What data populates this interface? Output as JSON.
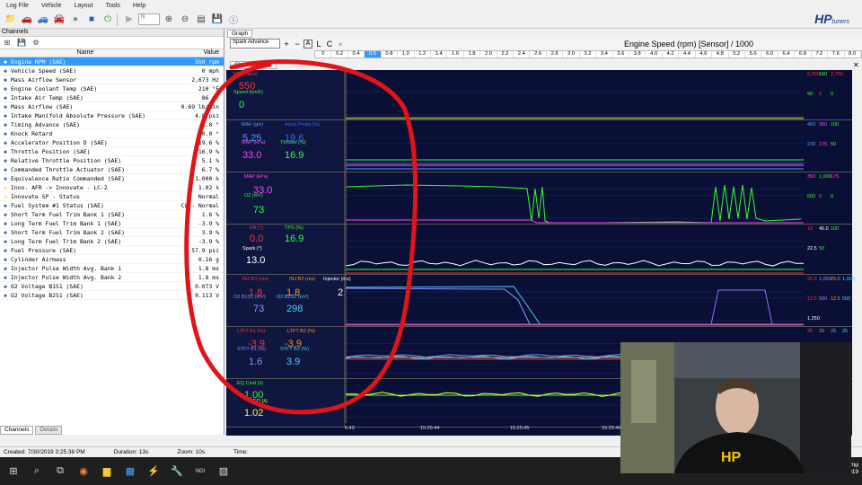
{
  "menu": [
    "Log File",
    "Vehicle",
    "Layout",
    "Tools",
    "Help"
  ],
  "toolbar": {
    "combo_value": "N"
  },
  "logo": {
    "text": "HP",
    "sub": "tuners"
  },
  "channels": {
    "header": "Channels",
    "col_name": "Name",
    "col_value": "Value",
    "rows": [
      {
        "name": "Engine RPM (SAE)",
        "value": "550 rpm",
        "selected": true
      },
      {
        "name": "Vehicle Speed (SAE)",
        "value": "0 mph"
      },
      {
        "name": "Mass Airflow Sensor",
        "value": "2,673 Hz"
      },
      {
        "name": "Engine Coolant Temp (SAE)",
        "value": "210 °F"
      },
      {
        "name": "Intake Air Temp (SAE)",
        "value": "86 °F"
      },
      {
        "name": "Mass Airflow (SAE)",
        "value": "0.69 lb/min"
      },
      {
        "name": "Intake Manifold Absolute Pressure (SAE)",
        "value": "4.8 psi"
      },
      {
        "name": "Timing Advance (SAE)",
        "value": "3.0 °"
      },
      {
        "name": "Knock Retard",
        "value": "0.0 °"
      },
      {
        "name": "Accelerator Position D (SAE)",
        "value": "19.6 %"
      },
      {
        "name": "Throttle Position (SAE)",
        "value": "16.9 %"
      },
      {
        "name": "Relative Throttle Position (SAE)",
        "value": "5.1 %"
      },
      {
        "name": "Commanded Throttle Actuator (SAE)",
        "value": "6.7 %"
      },
      {
        "name": "Equivalence Ratio Commanded (SAE)",
        "value": "1.000 λ"
      },
      {
        "name": "Inno. AFR -> Innovate - LC-2",
        "value": "1.02 λ",
        "warn": true
      },
      {
        "name": "Innovate SP - Status",
        "value": "Normal",
        "warn": true
      },
      {
        "name": "Fuel System #1 Status (SAE)",
        "value": "CL - Normal"
      },
      {
        "name": "Short Term Fuel Trim Bank 1 (SAE)",
        "value": "1.6 %"
      },
      {
        "name": "Long Term Fuel Trim Bank 1 (SAE)",
        "value": "-3.9 %"
      },
      {
        "name": "Short Term Fuel Trim Bank 2 (SAE)",
        "value": "3.9 %"
      },
      {
        "name": "Long Term Fuel Trim Bank 2 (SAE)",
        "value": "-3.9 %"
      },
      {
        "name": "Fuel Pressure (SAE)",
        "value": "57.9 psi"
      },
      {
        "name": "Cylinder Airmass",
        "value": "0.16 g"
      },
      {
        "name": "Injector Pulse Width Avg. Bank 1",
        "value": "1.8 ms"
      },
      {
        "name": "Injector Pulse Width Avg. Bank 2",
        "value": "1.8 ms"
      },
      {
        "name": "O2 Voltage B1S1 (SAE)",
        "value": "0.073 V"
      },
      {
        "name": "O2 Voltage B2S1 (SAE)",
        "value": "0.113 V"
      }
    ],
    "tabs": [
      "Channels",
      "Details"
    ]
  },
  "status": {
    "created": "Created: 7/30/2019 3:25:38 PM",
    "duration": "Duration: 13s",
    "zoom": "Zoom: 10s",
    "time": "Time:"
  },
  "graph": {
    "tab": "Graph",
    "select": "Spark Advance",
    "btn_a": "A",
    "btn_l": "L",
    "btn_c": "C",
    "title": "Engine Speed (rpm) [Sensor] / 1000",
    "scale": [
      "0",
      "0.2",
      "0.4",
      "0.6",
      "0.8",
      "1.0",
      "1.2",
      "1.4",
      "1.6",
      "1.8",
      "2.0",
      "2.2",
      "2.4",
      "2.6",
      "2.8",
      "3.0",
      "3.2",
      "3.4",
      "3.6",
      "3.8",
      "4.0",
      "4.2",
      "4.4",
      "4.6",
      "4.8",
      "5.2",
      "5.6",
      "6.0",
      "6.4",
      "6.8",
      "7.2",
      "7.6",
      "8.0"
    ],
    "scale_highlight": "0.6",
    "cvt_tab": "Chart vs. Time"
  },
  "lanes": [
    {
      "labels": [
        {
          "t": "RPM (rpm)",
          "c": "#ff3030"
        },
        {
          "t": "Speed (km/h)",
          "c": "#30ff30"
        }
      ],
      "values": [
        {
          "t": "550",
          "c": "#ff3030"
        },
        {
          "t": "0",
          "c": "#30ff30"
        }
      ],
      "right": [
        {
          "t": "5,500",
          "c": "#ff3030"
        },
        {
          "t": "180",
          "c": "#30ff30"
        },
        {
          "t": "2,750",
          "c": "#ff3030"
        },
        {
          "t": "90",
          "c": "#30ff30"
        },
        {
          "t": "0",
          "c": "#ff3030"
        },
        {
          "t": "0",
          "c": "#30ff30"
        }
      ]
    },
    {
      "labels": [
        {
          "t": "MAF (g/s)",
          "c": "#4aa0ff"
        },
        {
          "t": "Accel Pedal (%)",
          "c": "#4060ff"
        },
        {
          "t": "MAP (kPa)",
          "c": "#ff40ff"
        },
        {
          "t": "Throttle (%)",
          "c": "#30ff30"
        }
      ],
      "values": [
        {
          "t": "5.25",
          "c": "#4aa0ff"
        },
        {
          "t": "19.6",
          "c": "#4060ff"
        },
        {
          "t": "33.0",
          "c": "#ff40ff"
        },
        {
          "t": "16.9",
          "c": "#30ff30"
        }
      ],
      "right": [
        {
          "t": "460",
          "c": "#4aa0ff"
        },
        {
          "t": "350",
          "c": "#ff40ff"
        },
        {
          "t": "100",
          "c": "#30ff30"
        },
        {
          "t": "230",
          "c": "#4aa0ff"
        },
        {
          "t": "175",
          "c": "#ff40ff"
        },
        {
          "t": "50",
          "c": "#30ff30"
        }
      ]
    },
    {
      "labels": [
        {
          "t": "MAP (kPa)",
          "c": "#ff40ff"
        },
        {
          "t": "O2 (mV)",
          "c": "#30ff30"
        }
      ],
      "values": [
        {
          "t": "33.0",
          "c": "#ff40ff"
        },
        {
          "t": "73",
          "c": "#30ff30"
        }
      ],
      "right": [
        {
          "t": "350",
          "c": "#ff40ff"
        },
        {
          "t": "1,000",
          "c": "#30ff30"
        },
        {
          "t": "175",
          "c": "#ff40ff"
        },
        {
          "t": "500",
          "c": "#30ff30"
        },
        {
          "t": "0",
          "c": "#ff40ff"
        },
        {
          "t": "0",
          "c": "#30ff30"
        }
      ]
    },
    {
      "labels": [
        {
          "t": "KR (°)",
          "c": "#ff3030"
        },
        {
          "t": "TPS (%)",
          "c": "#30ff30"
        },
        {
          "t": "Spark (°)",
          "c": "#ffffff"
        }
      ],
      "values": [
        {
          "t": "0.0",
          "c": "#ff3030"
        },
        {
          "t": "16.9",
          "c": "#30ff30"
        },
        {
          "t": "13.0",
          "c": "#ffffff"
        }
      ],
      "right": [
        {
          "t": "10",
          "c": "#ff3030"
        },
        {
          "t": "45.0",
          "c": "#ffffff"
        },
        {
          "t": "100",
          "c": "#30ff30"
        },
        {
          "t": "22.5",
          "c": "#ffffff"
        },
        {
          "t": "50",
          "c": "#30ff30"
        }
      ]
    },
    {
      "labels": [
        {
          "t": "INJ B1 (ms)",
          "c": "#ff3030"
        },
        {
          "t": "INJ B2 (ms)",
          "c": "#ff9030"
        },
        {
          "t": "Injector (ms)",
          "c": "#ffffff"
        },
        {
          "t": "O2 B1S1 (mV)",
          "c": "#9090ff"
        },
        {
          "t": "O2 B2S1 (mV)",
          "c": "#40d0ff"
        }
      ],
      "values": [
        {
          "t": "1.8",
          "c": "#ff3030"
        },
        {
          "t": "1.8",
          "c": "#ff9030"
        },
        {
          "t": "2",
          "c": "#ffffff"
        },
        {
          "t": "73",
          "c": "#9090ff"
        },
        {
          "t": "298",
          "c": "#40d0ff"
        }
      ],
      "right": [
        {
          "t": "25.0",
          "c": "#ff3030"
        },
        {
          "t": "1,000",
          "c": "#9090ff"
        },
        {
          "t": "25.0",
          "c": "#ff9030"
        },
        {
          "t": "1,000",
          "c": "#40d0ff"
        },
        {
          "t": "12.5",
          "c": "#ff3030"
        },
        {
          "t": "500",
          "c": "#9090ff"
        },
        {
          "t": "12.5",
          "c": "#ff9030"
        },
        {
          "t": "500",
          "c": "#40d0ff"
        },
        {
          "t": "1,250",
          "c": "#ffffff"
        }
      ]
    },
    {
      "labels": [
        {
          "t": "LTFT B1 (%)",
          "c": "#ff3030"
        },
        {
          "t": "LTFT B2 (%)",
          "c": "#ff9030"
        },
        {
          "t": "STFT B1 (%)",
          "c": "#9090ff"
        },
        {
          "t": "STFT B2 (%)",
          "c": "#40d0ff"
        }
      ],
      "values": [
        {
          "t": "-3.9",
          "c": "#ff3030"
        },
        {
          "t": "-3.9",
          "c": "#ff9030"
        },
        {
          "t": "1.6",
          "c": "#9090ff"
        },
        {
          "t": "3.9",
          "c": "#40d0ff"
        }
      ],
      "right": [
        {
          "t": "25",
          "c": "#ff3030"
        },
        {
          "t": "25",
          "c": "#ff9030"
        },
        {
          "t": "25",
          "c": "#9090ff"
        },
        {
          "t": "25",
          "c": "#40d0ff"
        }
      ]
    },
    {
      "labels": [
        {
          "t": "EQ Cmd (λ)",
          "c": "#30ff30"
        },
        {
          "t": "EQ (λ)",
          "c": "#ffff30"
        }
      ],
      "values": [
        {
          "t": "1.00",
          "c": "#30ff30"
        },
        {
          "t": "1.02",
          "c": "#ffff30"
        }
      ],
      "right": []
    }
  ],
  "time_labels": [
    "5:43",
    "15:25:44",
    "15:25:45",
    "15:25:46",
    "15:25:47",
    "15:25:48"
  ],
  "taskbar": {
    "time": "3:25 PM",
    "date": "7/30/2019"
  },
  "webcam": {
    "shirt_text": "HP"
  }
}
